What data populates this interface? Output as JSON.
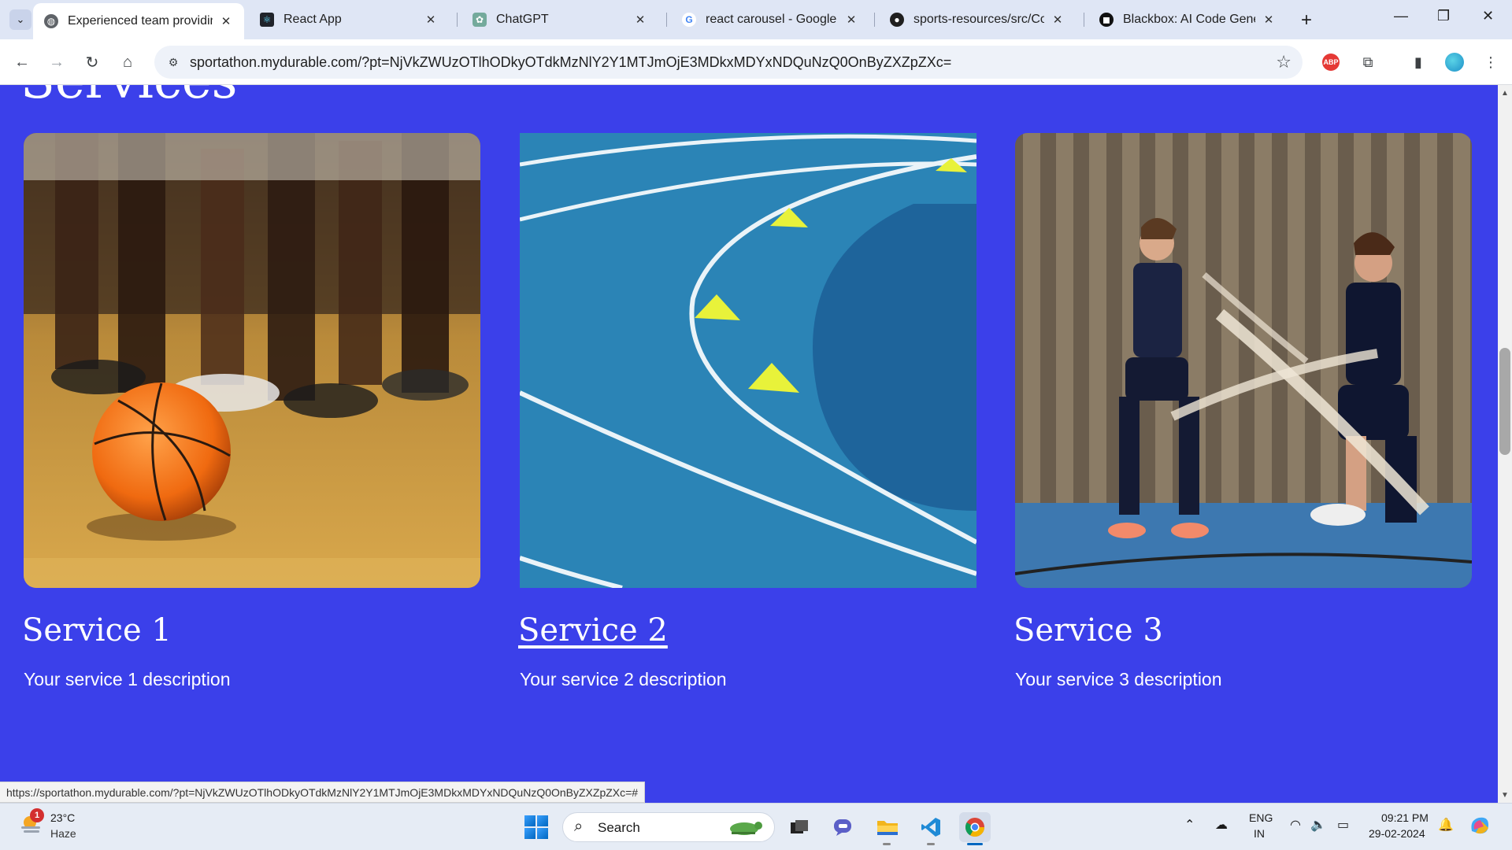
{
  "tabs": [
    {
      "title": "Experienced team providin",
      "active": true,
      "icon": "globe-icon"
    },
    {
      "title": "React App",
      "active": false,
      "icon": "react-icon"
    },
    {
      "title": "ChatGPT",
      "active": false,
      "icon": "chatgpt-icon"
    },
    {
      "title": "react carousel - Google Se",
      "active": false,
      "icon": "google-icon"
    },
    {
      "title": "sports-resources/src/Comp",
      "active": false,
      "icon": "github-icon"
    },
    {
      "title": "Blackbox: AI Code Generat",
      "active": false,
      "icon": "blackbox-icon"
    }
  ],
  "address_bar": {
    "url": "sportathon.mydurable.com/?pt=NjVkZWUzOTlhODkyOTdkMzNlY2Y1MTJmOjE3MDkxMDYxNDQuNzQ0OnByZXZpZXc="
  },
  "page": {
    "heading": "Services",
    "services": [
      {
        "title": "Service 1",
        "description": "Your service 1 description",
        "hovered": false
      },
      {
        "title": "Service 2",
        "description": "Your service 2 description",
        "hovered": true
      },
      {
        "title": "Service 3",
        "description": "Your service 3 description",
        "hovered": false
      }
    ]
  },
  "status_link": "https://sportathon.mydurable.com/?pt=NjVkZWUzOTlhODkyOTdkMzNlY2Y1MTJmOjE3MDkxMDYxNDQuNzQ0OnByZXZpZXc=#",
  "taskbar": {
    "weather": {
      "temp": "23°C",
      "condition": "Haze",
      "badge": "1"
    },
    "search_label": "Search",
    "language": {
      "line1": "ENG",
      "line2": "IN"
    },
    "clock": {
      "time": "09:21 PM",
      "date": "29-02-2024"
    }
  },
  "colors": {
    "page_background": "#3b40ea",
    "tab_strip": "#dfe6f5",
    "taskbar": "#e6ecf5"
  }
}
